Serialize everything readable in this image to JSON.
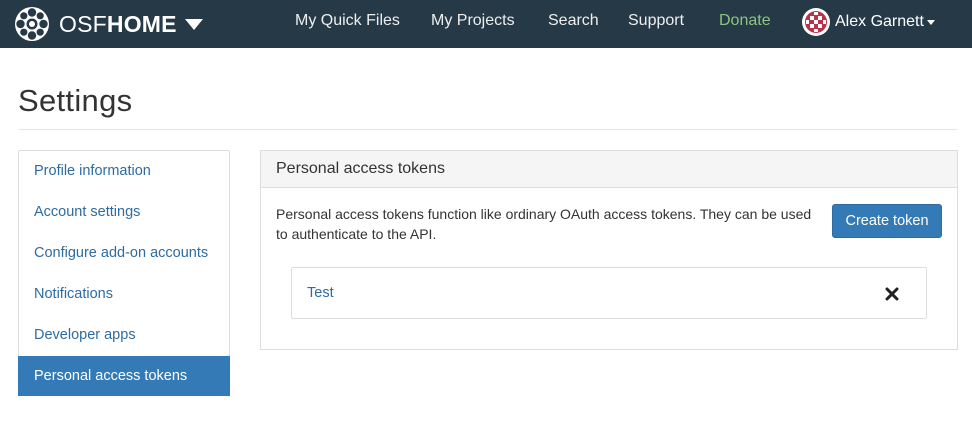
{
  "navbar": {
    "brand_prefix": "OSF",
    "brand_suffix": "HOME",
    "links": {
      "quick_files": "My Quick Files",
      "projects": "My Projects",
      "search": "Search",
      "support": "Support",
      "donate": "Donate"
    },
    "user_name": "Alex Garnett",
    "colors": {
      "background": "#263947",
      "donate": "#8cc581"
    }
  },
  "page": {
    "title": "Settings"
  },
  "sidebar": {
    "items": [
      {
        "label": "Profile information"
      },
      {
        "label": "Account settings"
      },
      {
        "label": "Configure add-on accounts"
      },
      {
        "label": "Notifications"
      },
      {
        "label": "Developer apps"
      },
      {
        "label": "Personal access tokens",
        "active": true
      }
    ],
    "accent": "#337ab7"
  },
  "panel": {
    "heading": "Personal access tokens",
    "description": "Personal access tokens function like ordinary OAuth access tokens. They can be used to authenticate to the API.",
    "create_label": "Create token",
    "tokens": [
      {
        "name": "Test"
      }
    ]
  },
  "icons": {
    "logo": "osf-logo-icon",
    "brand_caret": "caret-down-icon",
    "avatar": "avatar-icon",
    "user_caret": "caret-down-icon",
    "delete": "close-icon"
  }
}
